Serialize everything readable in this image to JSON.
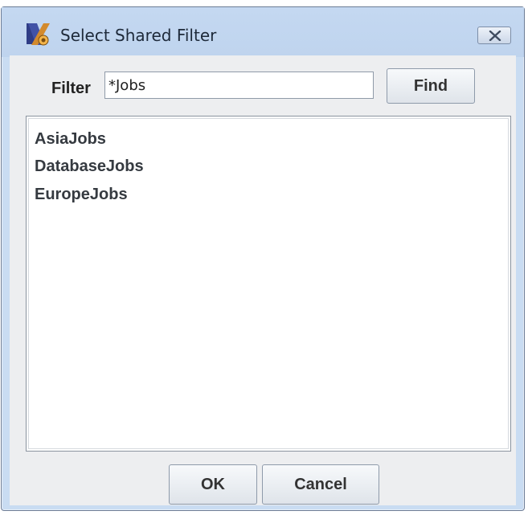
{
  "window": {
    "title": "Select Shared Filter",
    "app_icon": "app-logo-icon",
    "close_icon": "close-icon"
  },
  "filter": {
    "label": "Filter",
    "value": "*Jobs",
    "find_label": "Find"
  },
  "results": {
    "items": [
      "AsiaJobs",
      "DatabaseJobs",
      "EuropeJobs"
    ]
  },
  "footer": {
    "ok_label": "OK",
    "cancel_label": "Cancel"
  }
}
